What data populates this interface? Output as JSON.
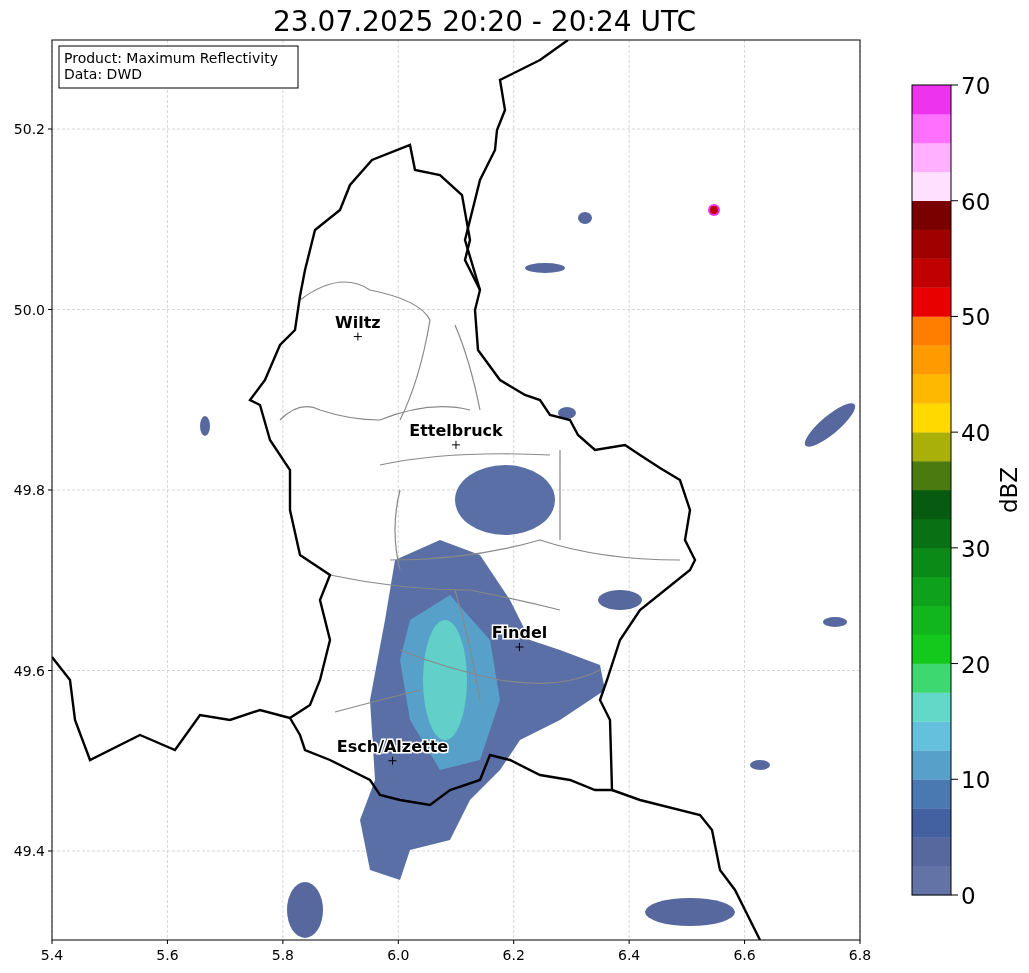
{
  "title": "23.07.2025 20:20 - 20:24 UTC",
  "info_box": [
    "Product: Maximum Reflectivity",
    "Data: DWD"
  ],
  "x_ticks": [
    "5.4",
    "5.6",
    "5.8",
    "6.0",
    "6.2",
    "6.4",
    "6.6",
    "6.8"
  ],
  "y_ticks": [
    "50.2",
    "50.0",
    "49.8",
    "49.6",
    "49.4"
  ],
  "cities": [
    {
      "name": "Wiltz"
    },
    {
      "name": "Ettelbruck"
    },
    {
      "name": "Findel"
    },
    {
      "name": "Esch/Alzette"
    }
  ],
  "colorbar": {
    "label": "dBZ",
    "ticks": [
      "70",
      "60",
      "50",
      "40",
      "30",
      "20",
      "10",
      "0"
    ],
    "bands": [
      {
        "color": "#6373a6"
      },
      {
        "color": "#56689e"
      },
      {
        "color": "#4360a0"
      },
      {
        "color": "#4a78b0"
      },
      {
        "color": "#57a0c9"
      },
      {
        "color": "#64c0dc"
      },
      {
        "color": "#62d8c8"
      },
      {
        "color": "#3dd870"
      },
      {
        "color": "#12c91c"
      },
      {
        "color": "#10b61b"
      },
      {
        "color": "#0ea11b"
      },
      {
        "color": "#0c8a17"
      },
      {
        "color": "#0a7014"
      },
      {
        "color": "#075b10"
      },
      {
        "color": "#4a7a10"
      },
      {
        "color": "#aab00a"
      },
      {
        "color": "#ffd900"
      },
      {
        "color": "#ffb800"
      },
      {
        "color": "#ff9b00"
      },
      {
        "color": "#ff7e00"
      },
      {
        "color": "#e80000"
      },
      {
        "color": "#c00000"
      },
      {
        "color": "#a00000"
      },
      {
        "color": "#7a0000"
      },
      {
        "color": "#ffe0ff"
      },
      {
        "color": "#ffb0ff"
      },
      {
        "color": "#ff70ff"
      },
      {
        "color": "#ee33ee"
      }
    ]
  }
}
